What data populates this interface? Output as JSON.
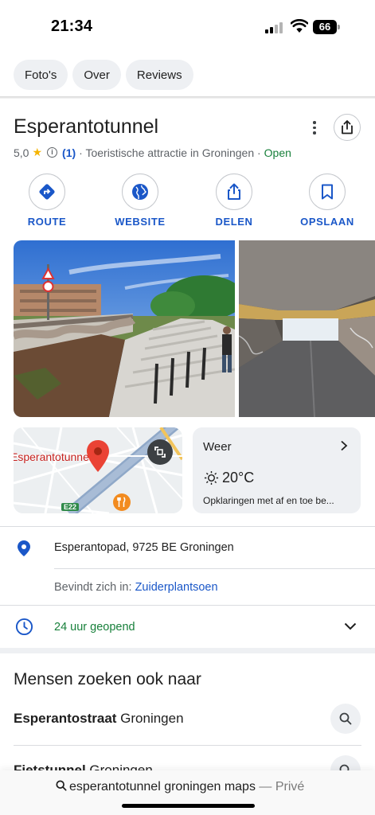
{
  "status_bar": {
    "time": "21:34",
    "battery": "66"
  },
  "tabs": [
    {
      "label": "Foto's"
    },
    {
      "label": "Over"
    },
    {
      "label": "Reviews"
    }
  ],
  "place": {
    "title": "Esperantotunnel",
    "rating": "5,0",
    "review_count": "(1)",
    "category": "· Toeristische attractie in Groningen ·",
    "status": "Open"
  },
  "actions": [
    {
      "label": "ROUTE",
      "icon": "directions-icon"
    },
    {
      "label": "WEBSITE",
      "icon": "globe-icon"
    },
    {
      "label": "DELEN",
      "icon": "share-icon"
    },
    {
      "label": "OPSLAAN",
      "icon": "bookmark-icon"
    }
  ],
  "map": {
    "label": "Esperantotunnel",
    "road": "E22"
  },
  "weather": {
    "title": "Weer",
    "temperature": "20°C",
    "description": "Opklaringen met af en toe be..."
  },
  "info": {
    "address": "Esperantopad, 9725 BE Groningen",
    "located_in_label": "Bevindt zich in:",
    "located_in_value": "Zuiderplantsoen",
    "hours": "24 uur geopend"
  },
  "people_also_search": {
    "title": "Mensen zoeken ook naar",
    "items": [
      {
        "bold": "Esperantostraat",
        "rest": " Groningen"
      },
      {
        "bold": "Fietstunnel",
        "rest": " Groningen"
      }
    ]
  },
  "browser": {
    "query": "esperantotunnel groningen maps",
    "separator": " — ",
    "mode": "Privé"
  },
  "colors": {
    "accent_blue": "#1a57c8",
    "open_green": "#18803b",
    "star_yellow": "#f5b400",
    "pin_red": "#ea4335"
  }
}
